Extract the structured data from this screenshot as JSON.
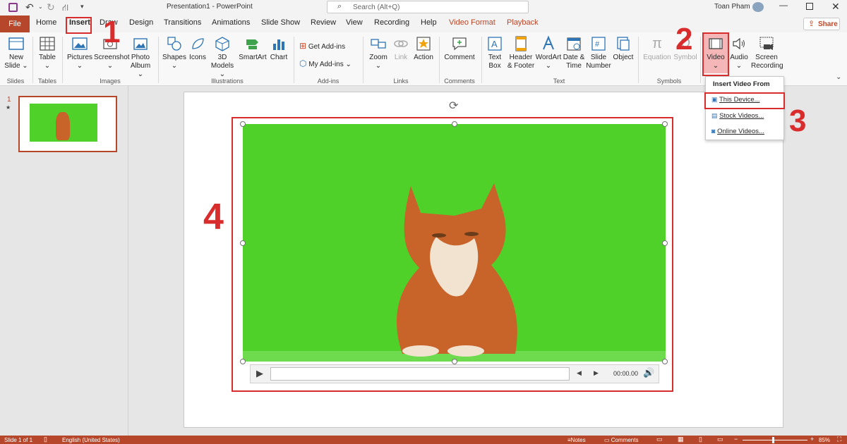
{
  "window": {
    "title": "Presentation1  -  PowerPoint",
    "user": "Toan Pham"
  },
  "search": {
    "placeholder": "Search (Alt+Q)"
  },
  "tabs": [
    "File",
    "Home",
    "Insert",
    "Draw",
    "Design",
    "Transitions",
    "Animations",
    "Slide Show",
    "Review",
    "View",
    "Recording",
    "Help",
    "Video Format",
    "Playback"
  ],
  "share_label": "Share",
  "ribbon": {
    "new_slide": [
      "New",
      "Slide"
    ],
    "table": "Table",
    "pictures": "Pictures",
    "screenshot": "Screenshot",
    "photo_album": [
      "Photo",
      "Album"
    ],
    "shapes": "Shapes",
    "icons": "Icons",
    "models3d": [
      "3D",
      "Models"
    ],
    "smartart": "SmartArt",
    "chart": "Chart",
    "get_addins": "Get Add-ins",
    "my_addins": "My Add-ins",
    "zoom": "Zoom",
    "link": "Link",
    "action": "Action",
    "comment": "Comment",
    "text_box": [
      "Text",
      "Box"
    ],
    "header_footer": [
      "Header",
      "& Footer"
    ],
    "wordart": "WordArt",
    "date_time": [
      "Date &",
      "Time"
    ],
    "slide_number": [
      "Slide",
      "Number"
    ],
    "object": "Object",
    "equation": "Equation",
    "symbol": "Symbol",
    "video": "Video",
    "audio": "Audio",
    "screen_recording": [
      "Screen",
      "Recording"
    ],
    "groups": [
      "Slides",
      "Tables",
      "Images",
      "Illustrations",
      "Add-ins",
      "Links",
      "Comments",
      "Text",
      "Symbols"
    ]
  },
  "dropdown": {
    "title": "Insert Video From",
    "items": [
      "This Device...",
      "Stock Videos...",
      "Online Videos..."
    ]
  },
  "thumbnail": {
    "number": "1",
    "star": "★"
  },
  "video": {
    "time": "00:00.00"
  },
  "annotations": [
    "1",
    "2",
    "3",
    "4"
  ],
  "status": {
    "slide": "Slide 1 of 1",
    "language": "English (United States)",
    "notes": "Notes",
    "comments": "Comments",
    "zoom": "85%"
  },
  "colors": {
    "accent": "#b7472a",
    "highlight": "#d92d2d",
    "green_screen": "#4fd12a"
  }
}
